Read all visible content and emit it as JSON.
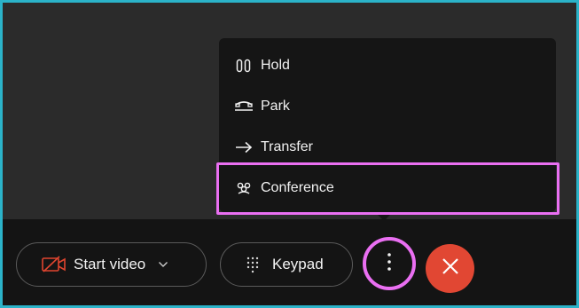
{
  "menu": {
    "items": [
      {
        "label": "Hold",
        "icon": "hold-icon"
      },
      {
        "label": "Park",
        "icon": "park-icon"
      },
      {
        "label": "Transfer",
        "icon": "transfer-arrow-icon"
      },
      {
        "label": "Conference",
        "icon": "conference-icon"
      }
    ],
    "highlighted_item": "Conference"
  },
  "controls": {
    "start_video_label": "Start video",
    "keypad_label": "Keypad",
    "more_icon": "more-vertical-icon",
    "end_call_icon": "close-icon"
  },
  "colors": {
    "highlight": "#ea6ff2",
    "end_call": "#e14733",
    "video_off_icon": "#e0452f",
    "frame_border": "#2bb3c9"
  }
}
